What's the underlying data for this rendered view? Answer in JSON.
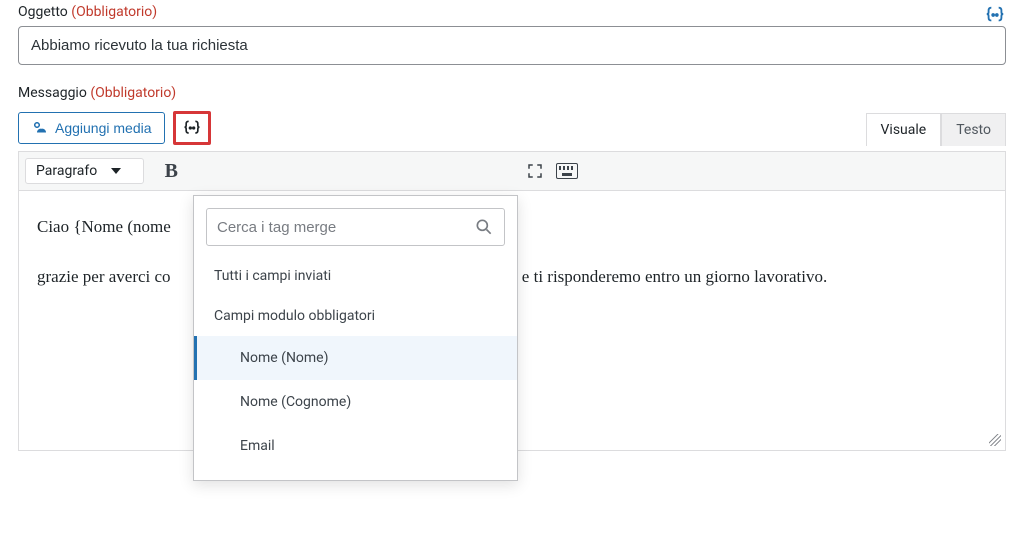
{
  "subject": {
    "label": "Oggetto",
    "required_label": "(Obbligatorio)",
    "value": "Abbiamo ricevuto la tua richiesta"
  },
  "message": {
    "label": "Messaggio",
    "required_label": "(Obbligatorio)",
    "add_media_label": "Aggiungi media",
    "format_select": "Paragrafo",
    "body_line1": "Ciao {Nome (nome ",
    "body_line2_a": "grazie per averci co",
    "body_line2_b": "o e ti risponderemo entro un giorno lavorativo."
  },
  "tabs": {
    "visual": "Visuale",
    "text": "Testo"
  },
  "dropdown": {
    "search_placeholder": "Cerca i tag merge",
    "section_all": "Tutti i campi inviati",
    "section_required": "Campi modulo obbligatori",
    "items": {
      "name_first": "Nome (Nome)",
      "name_last": "Nome (Cognome)",
      "email": "Email"
    }
  }
}
